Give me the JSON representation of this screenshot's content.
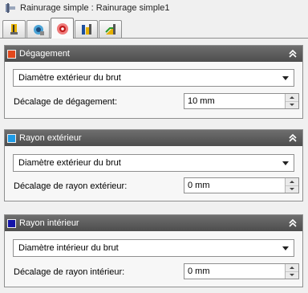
{
  "window": {
    "title": "Rainurage simple : Rainurage simple1"
  },
  "tabs": [
    {
      "icon": "tool-holder-icon"
    },
    {
      "icon": "groove-tool-icon"
    },
    {
      "icon": "clearance-icon",
      "active": true
    },
    {
      "icon": "linking-icon"
    },
    {
      "icon": "passes-icon"
    }
  ],
  "sections": [
    {
      "title": "Dégagement",
      "color": "#e2481c",
      "select_value": "Diamètre extérieur du brut",
      "field_label": "Décalage de dégagement:",
      "field_value": "10 mm"
    },
    {
      "title": "Rayon extérieur",
      "color": "#1e9be6",
      "select_value": "Diamètre extérieur du brut",
      "field_label": "Décalage de rayon extérieur:",
      "field_value": "0 mm"
    },
    {
      "title": "Rayon intérieur",
      "color": "#1414a8",
      "select_value": "Diamètre intérieur du brut",
      "field_label": "Décalage de rayon intérieur:",
      "field_value": "0 mm"
    }
  ]
}
